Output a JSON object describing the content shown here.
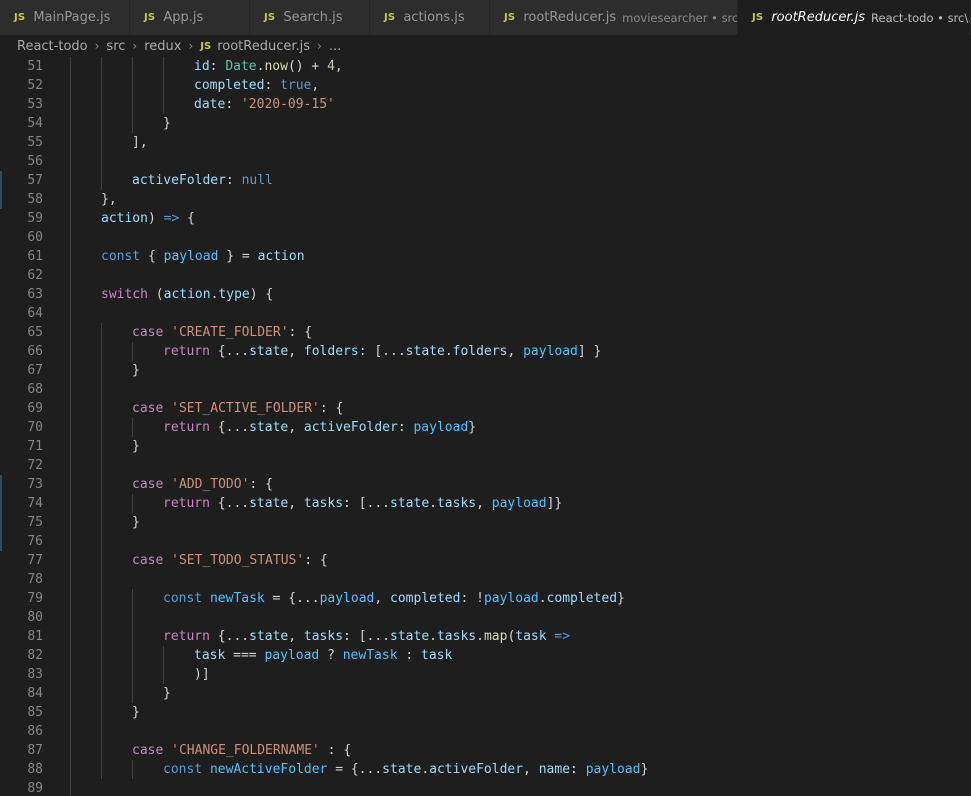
{
  "tabs": [
    {
      "title": "MainPage.js",
      "description": "",
      "icon": "js-icon",
      "active": false
    },
    {
      "title": "App.js",
      "description": "",
      "icon": "js-icon",
      "active": false
    },
    {
      "title": "Search.js",
      "description": "",
      "icon": "js-icon",
      "active": false
    },
    {
      "title": "actions.js",
      "description": "",
      "icon": "js-icon",
      "active": false
    },
    {
      "title": "rootReducer.js",
      "description": "moviesearcher • src\\...",
      "icon": "js-icon",
      "active": false
    },
    {
      "title": "rootReducer.js",
      "description": "React-todo • src\\...",
      "icon": "js-icon",
      "active": true
    }
  ],
  "tab_icon_label": "JS",
  "breadcrumb": [
    "React-todo",
    "src",
    "redux",
    "rootReducer.js",
    "..."
  ],
  "colors": {
    "keyword": "#c586c0",
    "declaration": "#569cd6",
    "string": "#ce9178",
    "number": "#b5cea8",
    "class": "#4ec9b0",
    "function": "#dcdcaa",
    "variable": "#9cdcfe",
    "constant": "#4fc1ff",
    "plain": "#d4d4d4",
    "js_icon": "#cbcb41"
  },
  "code_lines": [
    {
      "n": "51",
      "indent": 4,
      "tokens": [
        [
          "var",
          "id"
        ],
        [
          "plain",
          ": "
        ],
        [
          "cls",
          "Date"
        ],
        [
          "plain",
          "."
        ],
        [
          "fn",
          "now"
        ],
        [
          "plain",
          "() + "
        ],
        [
          "num",
          "4"
        ],
        [
          "plain",
          ","
        ]
      ]
    },
    {
      "n": "52",
      "indent": 4,
      "tokens": [
        [
          "var",
          "completed"
        ],
        [
          "plain",
          ": "
        ],
        [
          "dec",
          "true"
        ],
        [
          "plain",
          ","
        ]
      ]
    },
    {
      "n": "53",
      "indent": 4,
      "tokens": [
        [
          "var",
          "date"
        ],
        [
          "plain",
          ": "
        ],
        [
          "str",
          "'2020-09-15'"
        ]
      ]
    },
    {
      "n": "54",
      "indent": 3,
      "tokens": [
        [
          "plain",
          "}"
        ]
      ]
    },
    {
      "n": "55",
      "indent": 2,
      "tokens": [
        [
          "plain",
          "],"
        ]
      ]
    },
    {
      "n": "56",
      "indent": 0,
      "tokens": []
    },
    {
      "n": "57",
      "indent": 2,
      "tokens": [
        [
          "var",
          "activeFolder"
        ],
        [
          "plain",
          ": "
        ],
        [
          "dec",
          "null"
        ]
      ]
    },
    {
      "n": "58",
      "indent": 1,
      "tokens": [
        [
          "plain",
          "},"
        ]
      ]
    },
    {
      "n": "59",
      "indent": 1,
      "tokens": [
        [
          "var",
          "action"
        ],
        [
          "plain",
          ") "
        ],
        [
          "dec",
          "=>"
        ],
        [
          "plain",
          " {"
        ]
      ]
    },
    {
      "n": "60",
      "indent": 0,
      "tokens": []
    },
    {
      "n": "61",
      "indent": 1,
      "tokens": [
        [
          "dec",
          "const"
        ],
        [
          "plain",
          " { "
        ],
        [
          "const",
          "payload"
        ],
        [
          "plain",
          " } = "
        ],
        [
          "var",
          "action"
        ]
      ]
    },
    {
      "n": "62",
      "indent": 0,
      "tokens": []
    },
    {
      "n": "63",
      "indent": 1,
      "tokens": [
        [
          "kw",
          "switch"
        ],
        [
          "plain",
          " ("
        ],
        [
          "var",
          "action"
        ],
        [
          "plain",
          "."
        ],
        [
          "var",
          "type"
        ],
        [
          "plain",
          ") {"
        ]
      ]
    },
    {
      "n": "64",
      "indent": 0,
      "tokens": []
    },
    {
      "n": "65",
      "indent": 2,
      "tokens": [
        [
          "kw",
          "case"
        ],
        [
          "plain",
          " "
        ],
        [
          "str",
          "'CREATE_FOLDER'"
        ],
        [
          "plain",
          ": {"
        ]
      ]
    },
    {
      "n": "66",
      "indent": 3,
      "tokens": [
        [
          "kw",
          "return"
        ],
        [
          "plain",
          " {..."
        ],
        [
          "var",
          "state"
        ],
        [
          "plain",
          ", "
        ],
        [
          "var",
          "folders"
        ],
        [
          "plain",
          ": [..."
        ],
        [
          "var",
          "state"
        ],
        [
          "plain",
          "."
        ],
        [
          "var",
          "folders"
        ],
        [
          "plain",
          ", "
        ],
        [
          "const",
          "payload"
        ],
        [
          "plain",
          "] }"
        ]
      ]
    },
    {
      "n": "67",
      "indent": 2,
      "tokens": [
        [
          "plain",
          "}"
        ]
      ]
    },
    {
      "n": "68",
      "indent": 0,
      "tokens": []
    },
    {
      "n": "69",
      "indent": 2,
      "tokens": [
        [
          "kw",
          "case"
        ],
        [
          "plain",
          " "
        ],
        [
          "str",
          "'SET_ACTIVE_FOLDER'"
        ],
        [
          "plain",
          ": {"
        ]
      ]
    },
    {
      "n": "70",
      "indent": 3,
      "tokens": [
        [
          "kw",
          "return"
        ],
        [
          "plain",
          " {..."
        ],
        [
          "var",
          "state"
        ],
        [
          "plain",
          ", "
        ],
        [
          "var",
          "activeFolder"
        ],
        [
          "plain",
          ": "
        ],
        [
          "const",
          "payload"
        ],
        [
          "plain",
          "}"
        ]
      ]
    },
    {
      "n": "71",
      "indent": 2,
      "tokens": [
        [
          "plain",
          "}"
        ]
      ]
    },
    {
      "n": "72",
      "indent": 0,
      "tokens": []
    },
    {
      "n": "73",
      "indent": 2,
      "tokens": [
        [
          "kw",
          "case"
        ],
        [
          "plain",
          " "
        ],
        [
          "str",
          "'ADD_TODO'"
        ],
        [
          "plain",
          ": {"
        ]
      ]
    },
    {
      "n": "74",
      "indent": 3,
      "tokens": [
        [
          "kw",
          "return"
        ],
        [
          "plain",
          " {..."
        ],
        [
          "var",
          "state"
        ],
        [
          "plain",
          ", "
        ],
        [
          "var",
          "tasks"
        ],
        [
          "plain",
          ": [..."
        ],
        [
          "var",
          "state"
        ],
        [
          "plain",
          "."
        ],
        [
          "var",
          "tasks"
        ],
        [
          "plain",
          ", "
        ],
        [
          "const",
          "payload"
        ],
        [
          "plain",
          "]}"
        ]
      ]
    },
    {
      "n": "75",
      "indent": 2,
      "tokens": [
        [
          "plain",
          "}"
        ]
      ]
    },
    {
      "n": "76",
      "indent": 0,
      "tokens": []
    },
    {
      "n": "77",
      "indent": 2,
      "tokens": [
        [
          "kw",
          "case"
        ],
        [
          "plain",
          " "
        ],
        [
          "str",
          "'SET_TODO_STATUS'"
        ],
        [
          "plain",
          ": {"
        ]
      ]
    },
    {
      "n": "78",
      "indent": 0,
      "tokens": []
    },
    {
      "n": "79",
      "indent": 3,
      "tokens": [
        [
          "dec",
          "const"
        ],
        [
          "plain",
          " "
        ],
        [
          "const",
          "newTask"
        ],
        [
          "plain",
          " = {..."
        ],
        [
          "const",
          "payload"
        ],
        [
          "plain",
          ", "
        ],
        [
          "var",
          "completed"
        ],
        [
          "plain",
          ": !"
        ],
        [
          "const",
          "payload"
        ],
        [
          "plain",
          "."
        ],
        [
          "var",
          "completed"
        ],
        [
          "plain",
          "}"
        ]
      ]
    },
    {
      "n": "80",
      "indent": 0,
      "tokens": []
    },
    {
      "n": "81",
      "indent": 3,
      "tokens": [
        [
          "kw",
          "return"
        ],
        [
          "plain",
          " {..."
        ],
        [
          "var",
          "state"
        ],
        [
          "plain",
          ", "
        ],
        [
          "var",
          "tasks"
        ],
        [
          "plain",
          ": [..."
        ],
        [
          "var",
          "state"
        ],
        [
          "plain",
          "."
        ],
        [
          "var",
          "tasks"
        ],
        [
          "plain",
          "."
        ],
        [
          "fn",
          "map"
        ],
        [
          "plain",
          "("
        ],
        [
          "var",
          "task"
        ],
        [
          "plain",
          " "
        ],
        [
          "dec",
          "=>"
        ]
      ]
    },
    {
      "n": "82",
      "indent": 4,
      "tokens": [
        [
          "var",
          "task"
        ],
        [
          "plain",
          " === "
        ],
        [
          "const",
          "payload"
        ],
        [
          "plain",
          " ? "
        ],
        [
          "const",
          "newTask"
        ],
        [
          "plain",
          " : "
        ],
        [
          "var",
          "task"
        ]
      ]
    },
    {
      "n": "83",
      "indent": 4,
      "tokens": [
        [
          "plain",
          ")]"
        ]
      ]
    },
    {
      "n": "84",
      "indent": 3,
      "tokens": [
        [
          "plain",
          "}"
        ]
      ]
    },
    {
      "n": "85",
      "indent": 2,
      "tokens": [
        [
          "plain",
          "}"
        ]
      ]
    },
    {
      "n": "86",
      "indent": 0,
      "tokens": []
    },
    {
      "n": "87",
      "indent": 2,
      "tokens": [
        [
          "kw",
          "case"
        ],
        [
          "plain",
          " "
        ],
        [
          "str",
          "'CHANGE_FOLDERNAME'"
        ],
        [
          "plain",
          " : {"
        ]
      ]
    },
    {
      "n": "88",
      "indent": 3,
      "tokens": [
        [
          "dec",
          "const"
        ],
        [
          "plain",
          " "
        ],
        [
          "const",
          "newActiveFolder"
        ],
        [
          "plain",
          " = {..."
        ],
        [
          "var",
          "state"
        ],
        [
          "plain",
          "."
        ],
        [
          "var",
          "activeFolder"
        ],
        [
          "plain",
          ", "
        ],
        [
          "var",
          "name"
        ],
        [
          "plain",
          ": "
        ],
        [
          "const",
          "payload"
        ],
        [
          "plain",
          "}"
        ]
      ]
    },
    {
      "n": "89",
      "indent": 0,
      "tokens": []
    }
  ]
}
